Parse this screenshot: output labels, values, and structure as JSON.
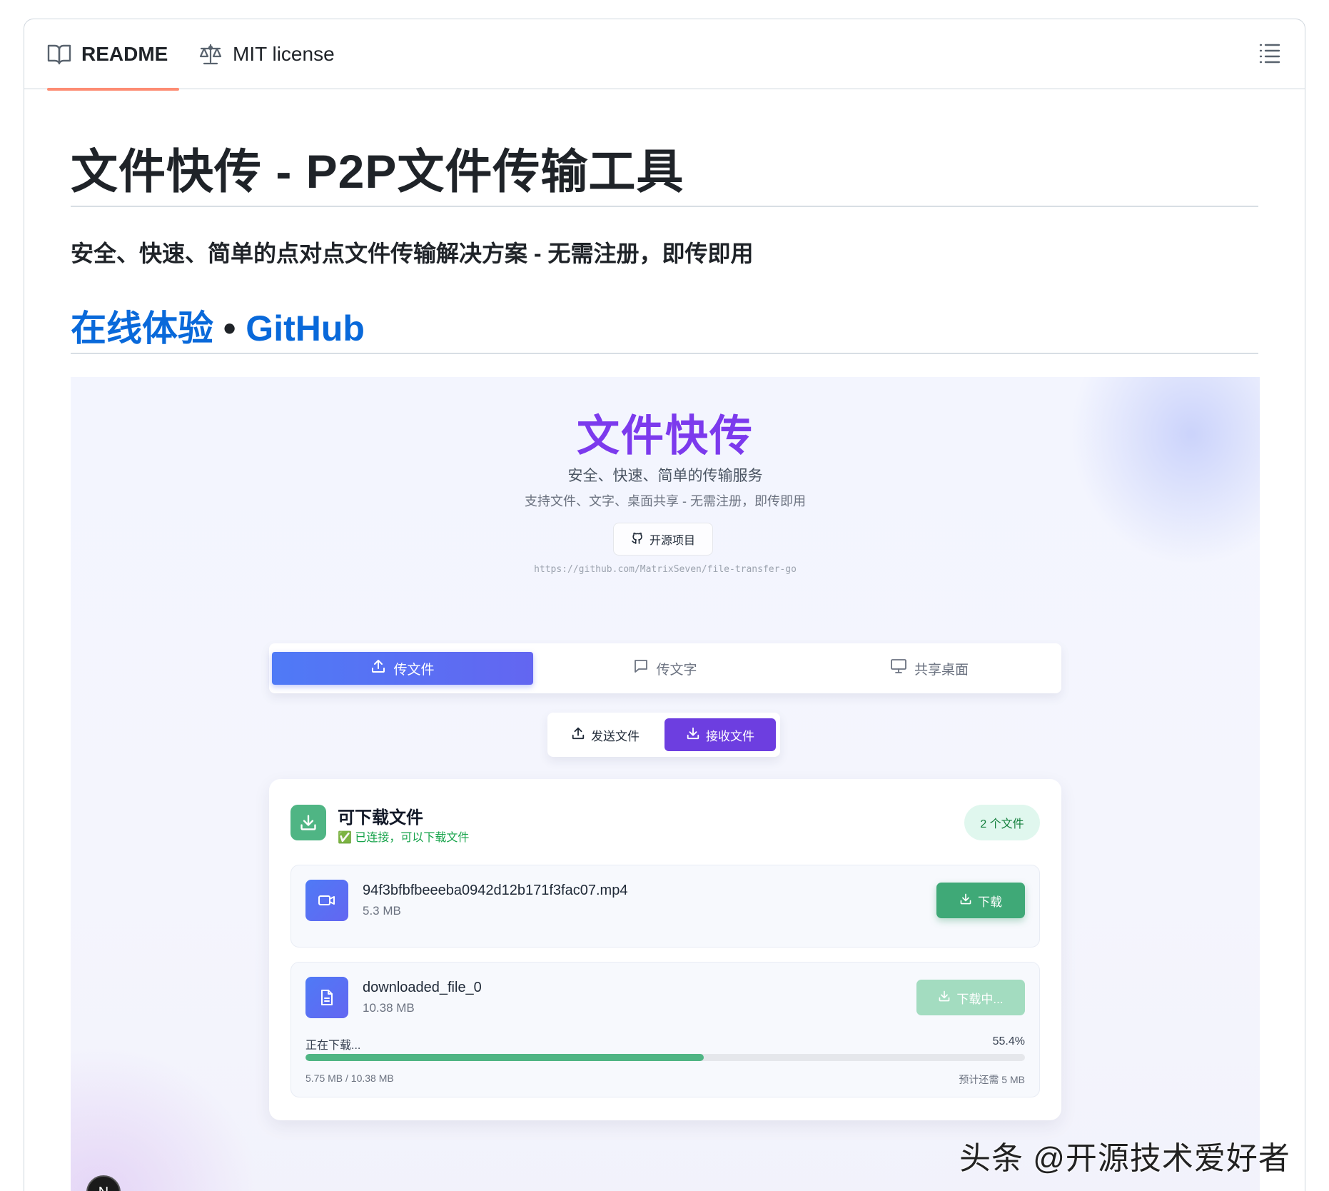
{
  "tabs": {
    "readme": "README",
    "license": "MIT license"
  },
  "readme": {
    "title": "文件快传 - P2P文件传输工具",
    "subtitle": "安全、快速、简单的点对点文件传输解决方案 - 无需注册，即传即用",
    "link_demo": "在线体验",
    "link_separator": " • ",
    "link_github": "GitHub"
  },
  "app": {
    "title": "文件快传",
    "tagline": "安全、快速、简单的传输服务",
    "features": "支持文件、文字、桌面共享 - 无需注册，即传即用",
    "oss_button": "开源项目",
    "repo_url": "https://github.com/MatrixSeven/file-transfer-go",
    "mode_tabs": [
      "传文件",
      "传文字",
      "共享桌面"
    ],
    "send_label": "发送文件",
    "receive_label": "接收文件",
    "card": {
      "title": "可下载文件",
      "status": "✅ 已连接，可以下载文件",
      "count": "2 个文件"
    },
    "files": [
      {
        "name": "94f3bfbfbeeeba0942d12b171f3fac07.mp4",
        "size": "5.3 MB",
        "button": "下载"
      },
      {
        "name": "downloaded_file_0",
        "size": "10.38 MB",
        "button": "下载中...",
        "progress_label": "正在下载...",
        "progress_pct": "55.4%",
        "progress": 0.554,
        "bytes": "5.75 MB / 10.38 MB",
        "eta": "预计还需 5 MB"
      }
    ],
    "badge_letter": "N"
  },
  "watermark": "头条 @开源技术爱好者",
  "colors": {
    "accent_purple": "#7c3aed",
    "accent_blue": "#4f7af6",
    "accent_green": "#3fa977",
    "link_blue": "#0969da",
    "tab_underline": "#fd8c73"
  }
}
